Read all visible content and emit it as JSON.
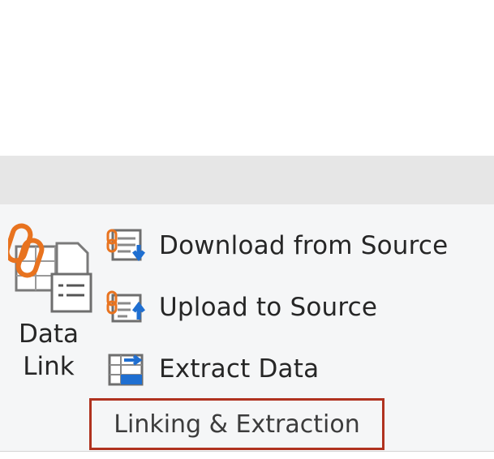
{
  "ribbon": {
    "group_label": "Linking & Extraction",
    "data_link": {
      "label": "Data\nLink",
      "icon": "data-link-icon"
    },
    "buttons": [
      {
        "label": "Download from Source",
        "icon": "download-from-source-icon"
      },
      {
        "label": "Upload to Source",
        "icon": "upload-to-source-icon"
      },
      {
        "label": "Extract  Data",
        "icon": "extract-data-icon"
      }
    ]
  },
  "colors": {
    "tab_strip": "#e6e6e6",
    "panel": "#f5f6f7",
    "highlight_border": "#b0321f",
    "accent_orange": "#e8731f",
    "accent_blue": "#1f6fd1"
  }
}
